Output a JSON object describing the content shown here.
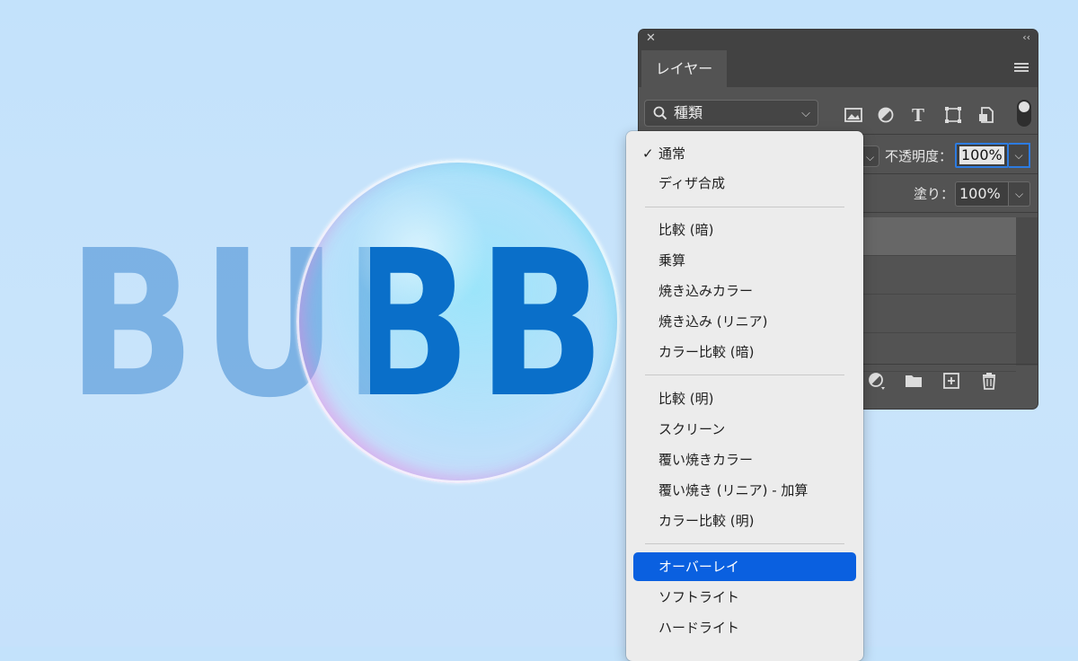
{
  "canvas": {
    "word": "BUBBLE"
  },
  "panel": {
    "close_glyph": "✕",
    "collapse_glyph": "‹‹",
    "tab_label": "レイヤー",
    "filter_label": "種類",
    "opacity_label": "不透明度：",
    "opacity_value": "100%",
    "fill_label": "塗り：",
    "fill_value": "100%"
  },
  "blend_menu": {
    "selected_index": 14,
    "checked_index": 0,
    "groups": [
      [
        "通常",
        "ディザ合成"
      ],
      [
        "比較 (暗)",
        "乗算",
        "焼き込みカラー",
        "焼き込み (リニア)",
        "カラー比較 (暗)"
      ],
      [
        "比較 (明)",
        "スクリーン",
        "覆い焼きカラー",
        "覆い焼き (リニア) - 加算",
        "カラー比較 (明)"
      ],
      [
        "オーバーレイ",
        "ソフトライト",
        "ハードライト"
      ]
    ],
    "items": [
      "通常",
      "ディザ合成",
      "比較 (暗)",
      "乗算",
      "焼き込みカラー",
      "焼き込み (リニア)",
      "カラー比較 (暗)",
      "比較 (明)",
      "スクリーン",
      "覆い焼きカラー",
      "覆い焼き (リニア) - 加算",
      "カラー比較 (明)",
      "オーバーレイ",
      "ソフトライト",
      "ハードライト"
    ]
  },
  "icons": {
    "filter_icons": [
      "image-icon",
      "adjustment-icon",
      "type-icon",
      "shape-icon",
      "smart-object-icon"
    ],
    "bottom_icons": [
      "adjustment-layer-icon",
      "folder-icon",
      "new-layer-icon",
      "trash-icon"
    ]
  },
  "colors": {
    "selection": "#0a60e0",
    "panel": "#535353",
    "focus": "#2d7be0"
  }
}
